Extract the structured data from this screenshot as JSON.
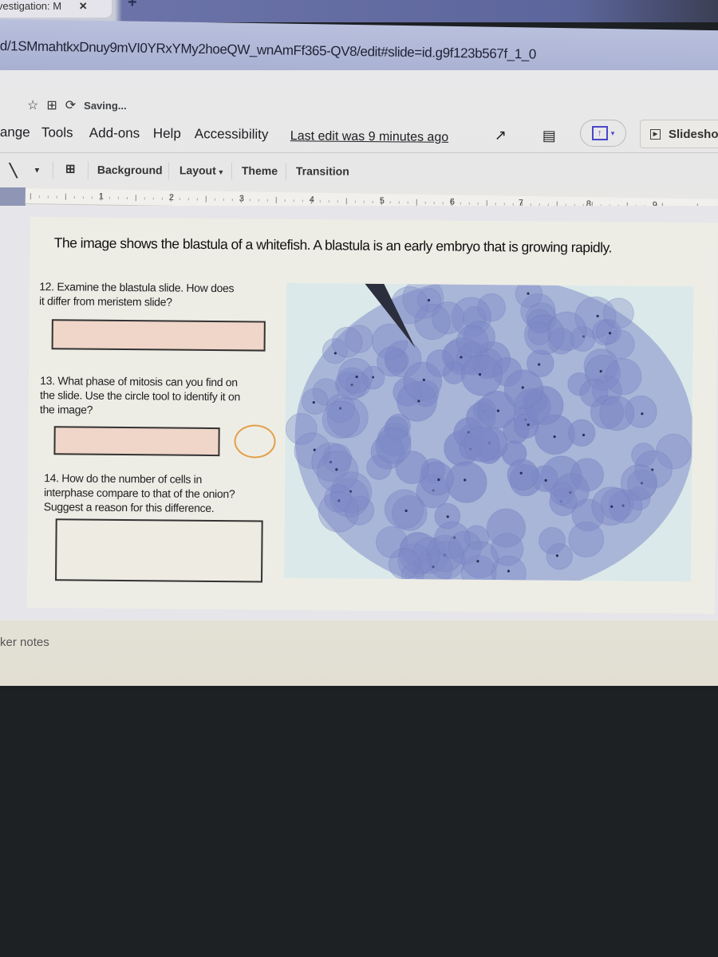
{
  "browser": {
    "tab_title": "ivestigation: M",
    "tab_close": "✕",
    "new_tab": "+",
    "url": "d/1SMmahtkxDnuy9mVI0YRxYMy2hoeQW_wnAmFf365-QV8/edit#slide=id.g9f123b567f_1_0"
  },
  "doc_header": {
    "star_icon": "☆",
    "move_icon": "⊞",
    "sync_icon": "⟳",
    "status": "Saving..."
  },
  "menu": {
    "items": [
      "ange",
      "Tools",
      "Add-ons",
      "Help",
      "Accessibility"
    ],
    "last_edit": "Last edit was 9 minutes ago",
    "activity_icon": "↗",
    "comment_icon": "▤",
    "share_icon": "↑",
    "share_caret": "▾",
    "slideshow_label": "Slidesho",
    "slideshow_icon": "▶"
  },
  "toolbar": {
    "line_icon": "╲",
    "line_caret": "▾",
    "comment_add_icon": "⊞",
    "background": "Background",
    "layout": "Layout",
    "layout_caret": "▾",
    "theme": "Theme",
    "transition": "Transition"
  },
  "ruler": {
    "numbers": [
      "1",
      "2",
      "3",
      "4",
      "5",
      "6",
      "7",
      "8",
      "9"
    ]
  },
  "slide": {
    "heading": "The image shows the blastula of a whitefish.  A blastula is an early embryo that is growing rapidly.",
    "questions": [
      {
        "number": "12",
        "line1": "12. Examine the blastula slide.  How does",
        "line2": "it differ from meristem slide?",
        "line3": "",
        "answer": ""
      },
      {
        "number": "13",
        "line1": "13. What phase of mitosis can you find on",
        "line2": "the slide.  Use the circle tool to identify it on",
        "line3": "the image?",
        "answer": ""
      },
      {
        "number": "14",
        "line1": "14. How do the number of cells in",
        "line2": "interphase compare to that of the onion?",
        "line3": "Suggest a reason for this difference.",
        "answer": ""
      }
    ],
    "image_alt": "Microscope image of whitefish blastula cells stained blue",
    "colors": {
      "answer_fill": "#efd6c9",
      "circle_stroke": "#e2a04a",
      "cell_blue": "#7d89c6"
    }
  },
  "notes": {
    "label": "ker notes"
  }
}
